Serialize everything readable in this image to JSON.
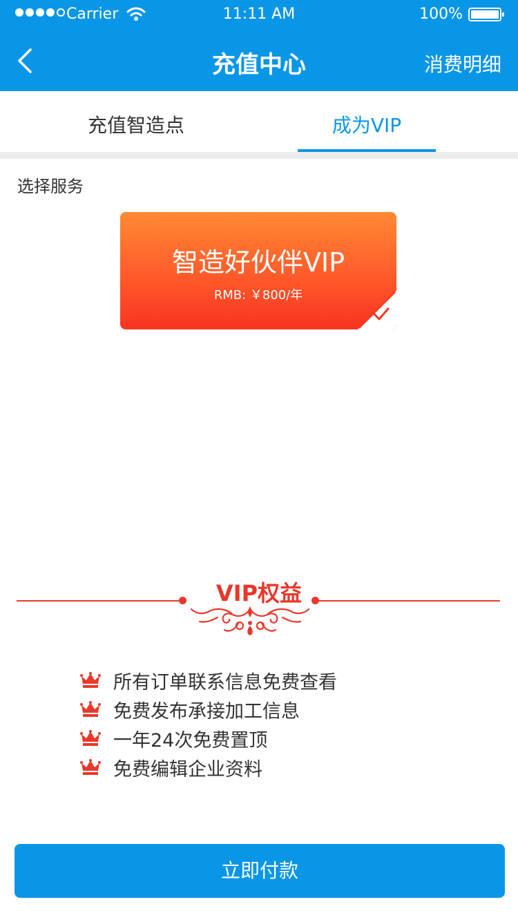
{
  "status_bar": {
    "carrier": "Carrier",
    "time": "11:11 AM",
    "battery": "100%"
  },
  "nav": {
    "title": "充值中心",
    "right_link": "消费明细"
  },
  "tabs": [
    {
      "label": "充值智造点",
      "active": false
    },
    {
      "label": "成为VIP",
      "active": true
    }
  ],
  "section_label": "选择服务",
  "vip_card": {
    "name": "智造好伙伴VIP",
    "price": "RMB: ￥800/年",
    "selected": true
  },
  "benefits": {
    "title": "VIP权益",
    "items": [
      "所有订单联系信息免费查看",
      "免费发布承接加工信息",
      "一年24次免费置顶",
      "免费编辑企业资料"
    ]
  },
  "pay_button": "立即付款",
  "colors": {
    "primary": "#0a96e6",
    "accent_red": "#e8382b",
    "card_gradient_top": "#ff8a35",
    "card_gradient_bottom": "#f83421"
  }
}
